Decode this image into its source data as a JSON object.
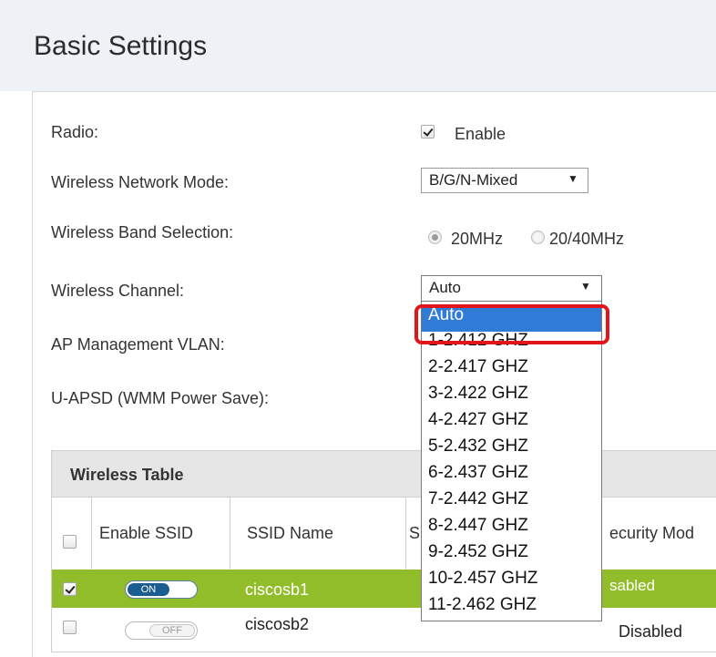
{
  "page": {
    "title": "Basic Settings"
  },
  "settings": {
    "radio": {
      "label": "Radio:",
      "checkbox_label": "Enable",
      "checked": true
    },
    "network_mode": {
      "label": "Wireless Network Mode:",
      "value": "B/G/N-Mixed"
    },
    "band": {
      "label": "Wireless Band Selection:",
      "option1": "20MHz",
      "option2": "20/40MHz",
      "selected": "20MHz"
    },
    "channel": {
      "label": "Wireless Channel:",
      "value": "Auto",
      "options": [
        "Auto",
        "1-2.412 GHZ",
        "2-2.417 GHZ",
        "3-2.422 GHZ",
        "4-2.427 GHZ",
        "5-2.432 GHZ",
        "6-2.437 GHZ",
        "7-2.442 GHZ",
        "8-2.447 GHZ",
        "9-2.452 GHZ",
        "10-2.457 GHZ",
        "11-2.462 GHZ"
      ],
      "highlighted": "Auto"
    },
    "ap_vlan": {
      "label": "AP Management VLAN:"
    },
    "uapsd": {
      "label": "U-APSD (WMM Power Save):"
    }
  },
  "table": {
    "title": "Wireless Table",
    "headers": {
      "enable_ssid": "Enable SSID",
      "ssid_name": "SSID Name",
      "s_partial": "S",
      "security": "ecurity Mod"
    },
    "rows": [
      {
        "checked": true,
        "toggle": "ON",
        "ssid": "ciscosb1",
        "status": "sabled"
      },
      {
        "checked": false,
        "toggle": "OFF",
        "ssid": "ciscosb2",
        "status": "Disabled"
      }
    ]
  },
  "colors": {
    "header_bg": "#eef1f5",
    "row_selected": "#92bd2b",
    "highlight": "#e2151b",
    "option_hl": "#2f7bd6"
  }
}
